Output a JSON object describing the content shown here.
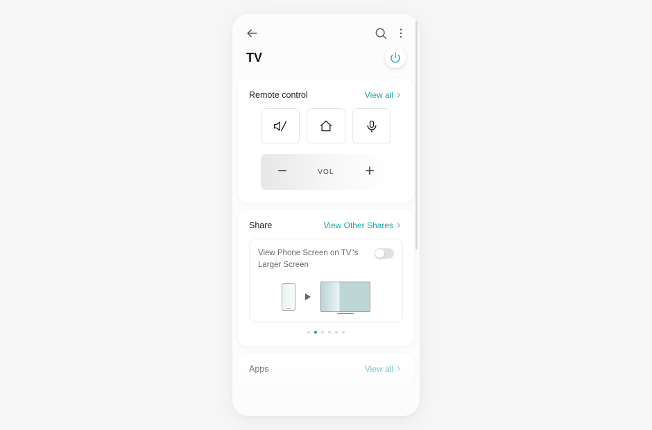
{
  "title": "TV",
  "colors": {
    "accent": "#1aa4a4"
  },
  "remote": {
    "title": "Remote control",
    "viewall": "View all",
    "vol_label": "VOL"
  },
  "share": {
    "title": "Share",
    "viewother": "View Other Shares",
    "cast_text": "View Phone Screen on TV\"s Larger Screen",
    "toggle_on": false,
    "pager_count": 6,
    "pager_active": 1
  },
  "apps": {
    "title": "Apps",
    "viewall": "View all"
  }
}
